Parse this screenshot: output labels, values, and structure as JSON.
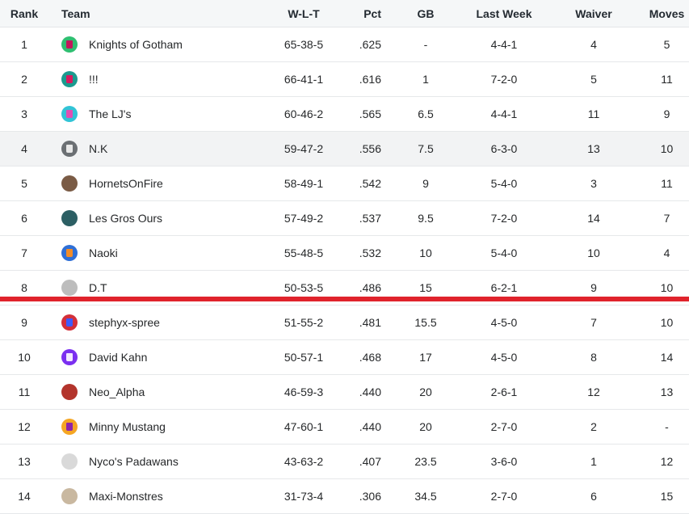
{
  "headers": {
    "rank": "Rank",
    "team": "Team",
    "wlt": "W-L-T",
    "pct": "Pct",
    "gb": "GB",
    "last_week": "Last Week",
    "waiver": "Waiver",
    "moves": "Moves"
  },
  "colors": {
    "cutline": "#e0232c"
  },
  "rows": [
    {
      "rank": "1",
      "team": "Knights of Gotham",
      "wlt": "65-38-5",
      "pct": ".625",
      "gb": "-",
      "last_week": "4-4-1",
      "waiver": "4",
      "moves": "5",
      "avatar_icon": "green-jersey-avatar"
    },
    {
      "rank": "2",
      "team": "!!!",
      "wlt": "66-41-1",
      "pct": ".616",
      "gb": "1",
      "last_week": "7-2-0",
      "waiver": "5",
      "moves": "11",
      "avatar_icon": "teal-jersey-avatar"
    },
    {
      "rank": "3",
      "team": "The LJ's",
      "wlt": "60-46-2",
      "pct": ".565",
      "gb": "6.5",
      "last_week": "4-4-1",
      "waiver": "11",
      "moves": "9",
      "avatar_icon": "cyan-jersey-avatar"
    },
    {
      "rank": "4",
      "team": "N.K",
      "wlt": "59-47-2",
      "pct": ".556",
      "gb": "7.5",
      "last_week": "6-3-0",
      "waiver": "13",
      "moves": "10",
      "avatar_icon": "gray-jersey-avatar"
    },
    {
      "rank": "5",
      "team": "HornetsOnFire",
      "wlt": "58-49-1",
      "pct": ".542",
      "gb": "9",
      "last_week": "5-4-0",
      "waiver": "3",
      "moves": "11",
      "avatar_icon": "photo-avatar"
    },
    {
      "rank": "6",
      "team": "Les Gros Ours",
      "wlt": "57-49-2",
      "pct": ".537",
      "gb": "9.5",
      "last_week": "7-2-0",
      "waiver": "14",
      "moves": "7",
      "avatar_icon": "photo-avatar"
    },
    {
      "rank": "7",
      "team": "Naoki",
      "wlt": "55-48-5",
      "pct": ".532",
      "gb": "10",
      "last_week": "5-4-0",
      "waiver": "10",
      "moves": "4",
      "avatar_icon": "blue-jersey-avatar"
    },
    {
      "rank": "8",
      "team": "D.T",
      "wlt": "50-53-5",
      "pct": ".486",
      "gb": "15",
      "last_week": "6-2-1",
      "waiver": "9",
      "moves": "10",
      "avatar_icon": "photo-avatar"
    },
    {
      "rank": "9",
      "team": "stephyx-spree",
      "wlt": "51-55-2",
      "pct": ".481",
      "gb": "15.5",
      "last_week": "4-5-0",
      "waiver": "7",
      "moves": "10",
      "avatar_icon": "red-jersey-avatar"
    },
    {
      "rank": "10",
      "team": "David Kahn",
      "wlt": "50-57-1",
      "pct": ".468",
      "gb": "17",
      "last_week": "4-5-0",
      "waiver": "8",
      "moves": "14",
      "avatar_icon": "purple-jersey-avatar"
    },
    {
      "rank": "11",
      "team": "Neo_Alpha",
      "wlt": "46-59-3",
      "pct": ".440",
      "gb": "20",
      "last_week": "2-6-1",
      "waiver": "12",
      "moves": "13",
      "avatar_icon": "photo-avatar"
    },
    {
      "rank": "12",
      "team": "Minny Mustang",
      "wlt": "47-60-1",
      "pct": ".440",
      "gb": "20",
      "last_week": "2-7-0",
      "waiver": "2",
      "moves": "-",
      "avatar_icon": "orange-jersey-avatar"
    },
    {
      "rank": "13",
      "team": "Nyco's Padawans",
      "wlt": "43-63-2",
      "pct": ".407",
      "gb": "23.5",
      "last_week": "3-6-0",
      "waiver": "1",
      "moves": "12",
      "avatar_icon": "photo-avatar"
    },
    {
      "rank": "14",
      "team": "Maxi-Monstres",
      "wlt": "31-73-4",
      "pct": ".306",
      "gb": "34.5",
      "last_week": "2-7-0",
      "waiver": "6",
      "moves": "15",
      "avatar_icon": "photo-avatar"
    }
  ]
}
